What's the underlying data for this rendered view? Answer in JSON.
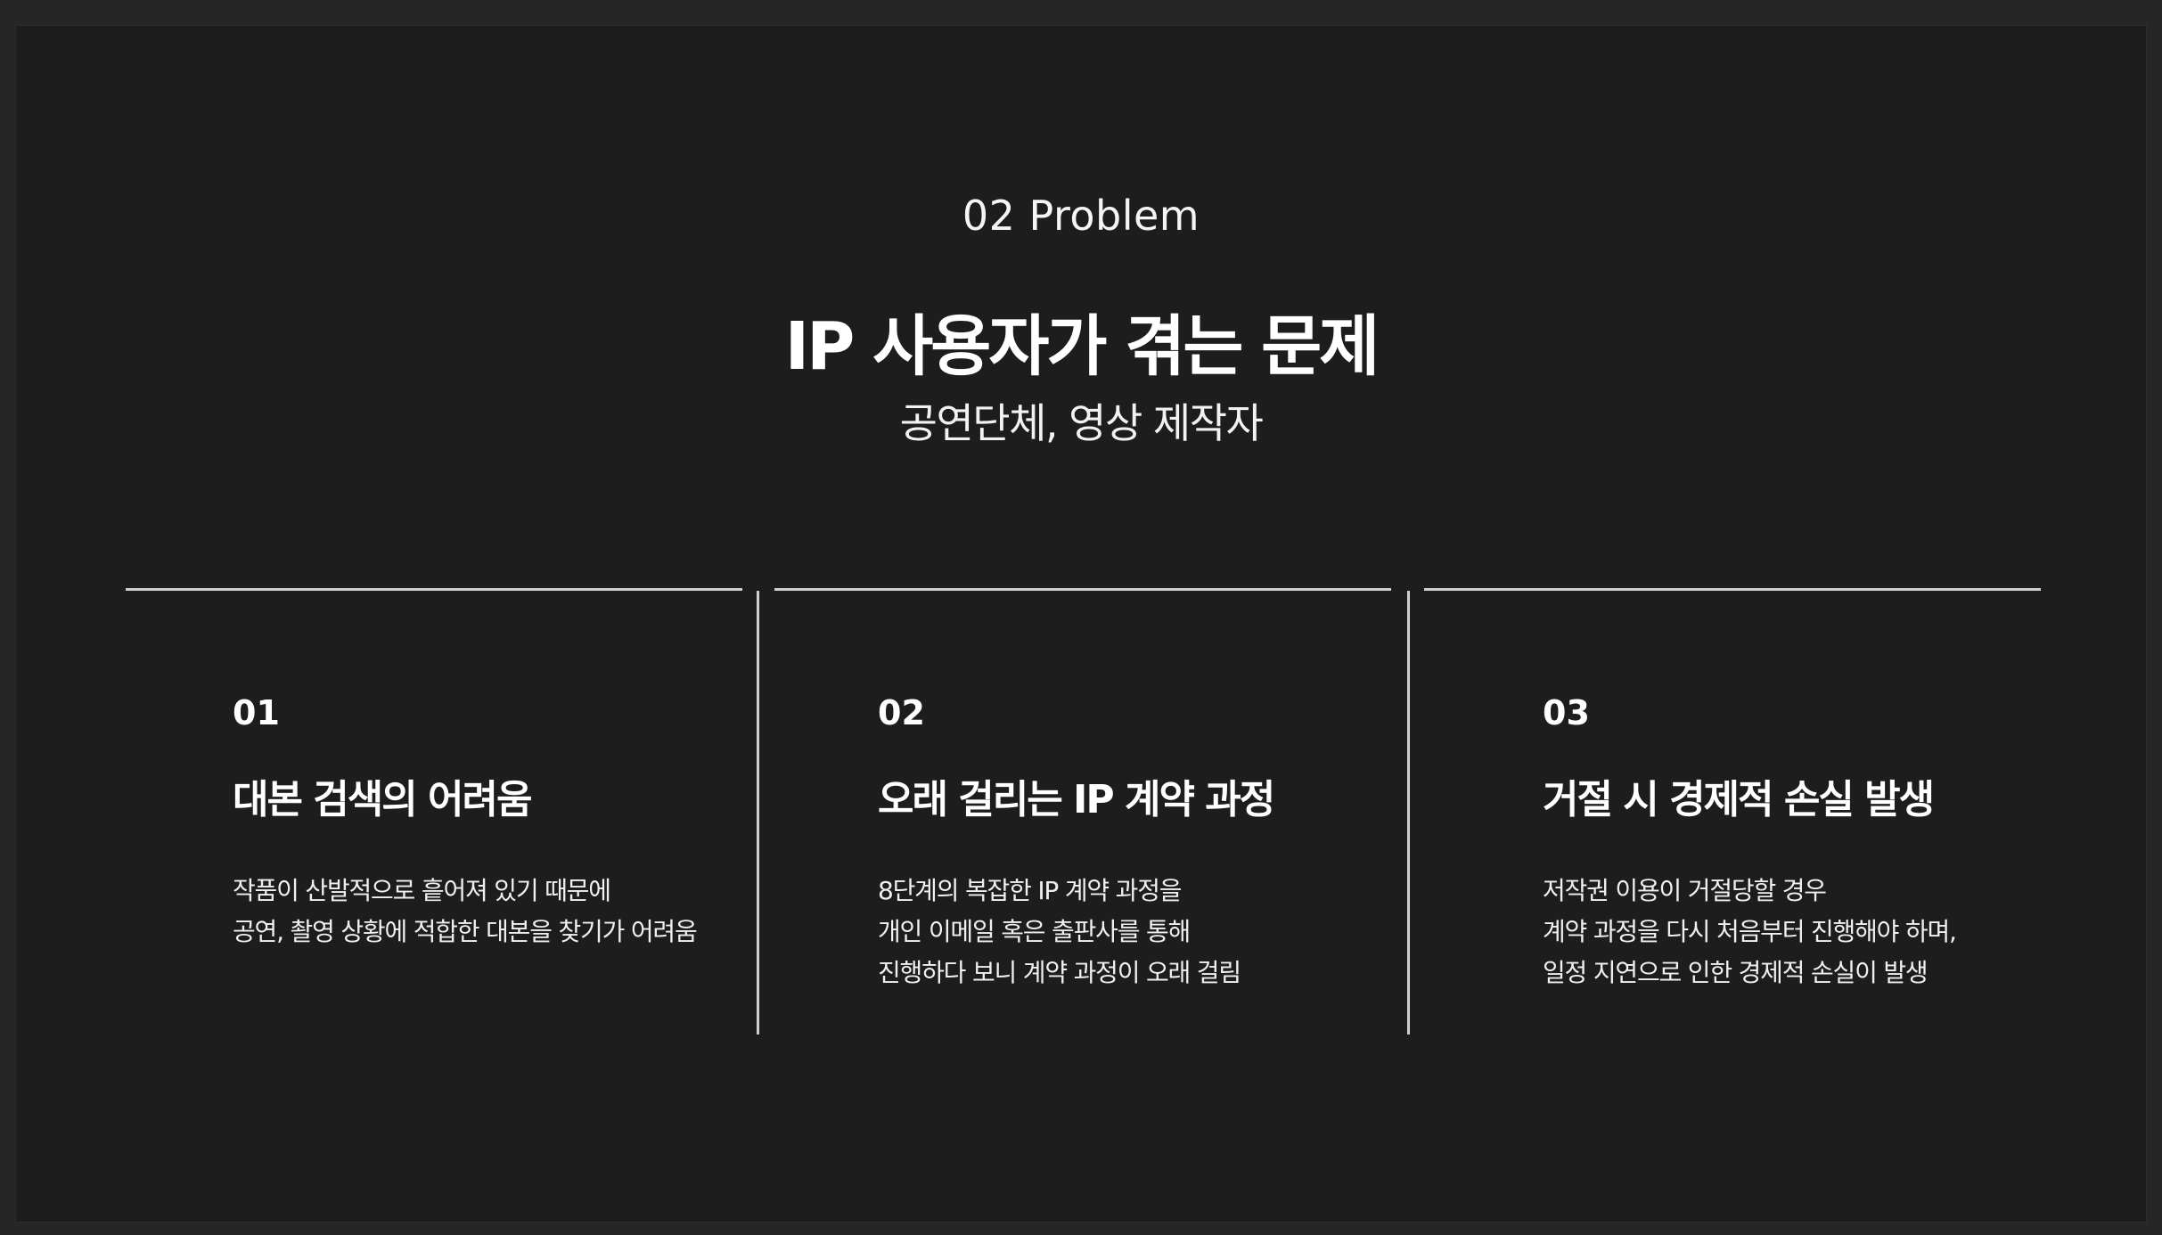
{
  "header": {
    "section_label": "02 Problem",
    "title": "IP 사용자가 겪는 문제",
    "subtitle": "공연단체, 영상 제작자"
  },
  "cards": [
    {
      "number": "01",
      "heading": "대본 검색의 어려움",
      "lines": [
        "작품이 산발적으로 흩어져 있기 때문에",
        "공연, 촬영 상황에 적합한 대본을 찾기가 어려움"
      ]
    },
    {
      "number": "02",
      "heading": "오래 걸리는 IP 계약 과정",
      "lines": [
        "8단계의 복잡한 IP 계약 과정을",
        "개인 이메일 혹은 출판사를 통해",
        "진행하다 보니 계약 과정이 오래 걸림"
      ]
    },
    {
      "number": "03",
      "heading": "거절 시 경제적 손실 발생",
      "lines": [
        "저작권 이용이 거절당할 경우",
        "계약 과정을 다시 처음부터 진행해야 하며,",
        "일정 지연으로 인한 경제적 손실이 발생"
      ]
    }
  ],
  "colors": {
    "background": "#1d1d1d",
    "text": "#ffffff",
    "divider": "#cfcfcf"
  }
}
